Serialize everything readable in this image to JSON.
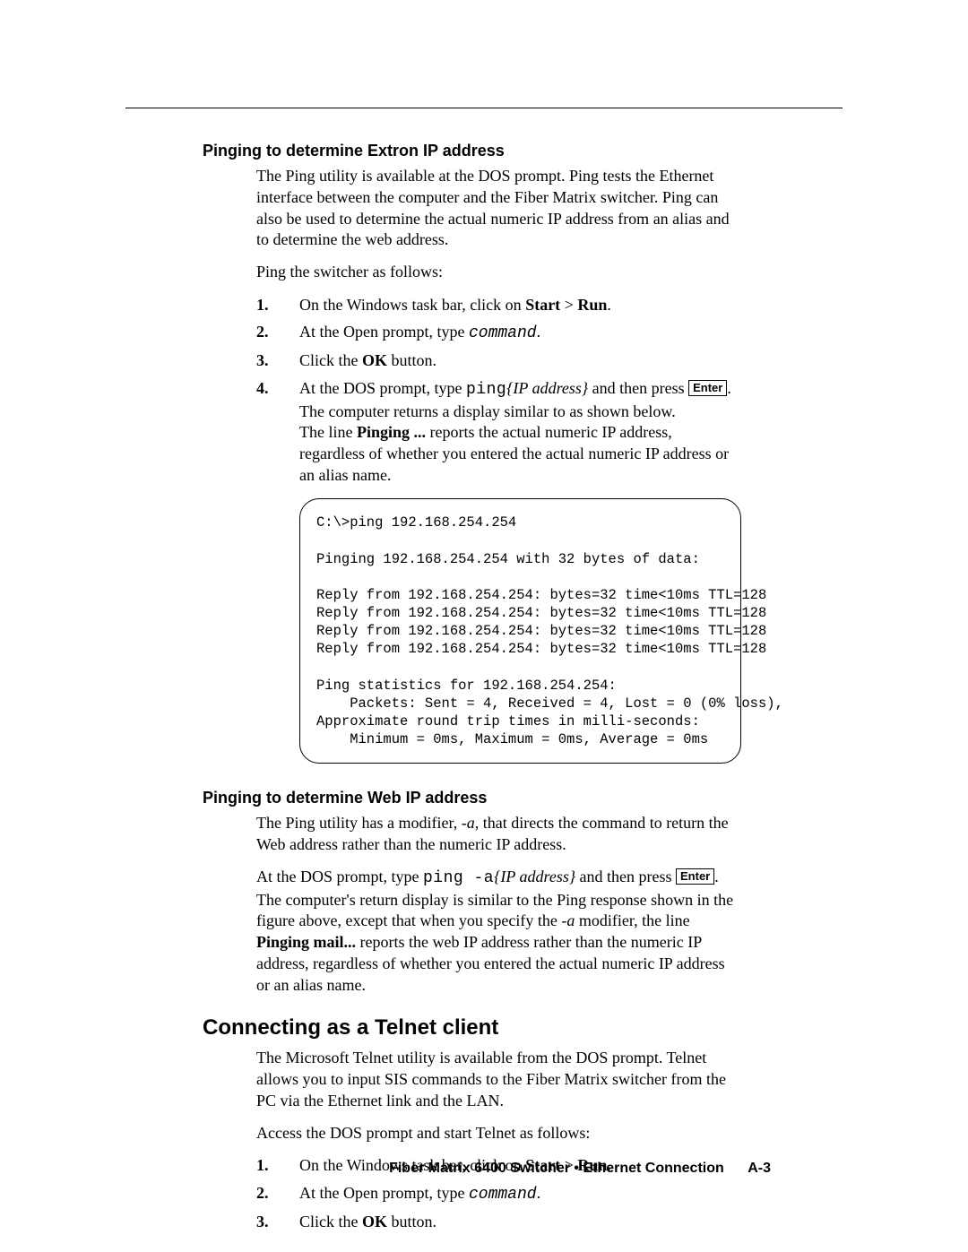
{
  "section1": {
    "heading": "Pinging to determine Extron IP address",
    "p1": "The Ping utility is available at the DOS prompt.  Ping tests the Ethernet interface between the computer and the Fiber Matrix switcher.  Ping can also be used to determine the actual numeric IP address from an alias and to determine the web address.",
    "p2": "Ping the switcher as follows:",
    "steps": {
      "s1": {
        "num": "1",
        "a": "On the Windows task bar, click on ",
        "b": "Start",
        "c": " > ",
        "d": "Run",
        "e": "."
      },
      "s2": {
        "num": "2",
        "a": "At the Open prompt, type ",
        "cmd": "command",
        "b": "."
      },
      "s3": {
        "num": "3",
        "a": "Click the ",
        "ok": "OK",
        "b": " button."
      },
      "s4": {
        "num": "4",
        "a": "At the DOS prompt, type ",
        "cmd": "ping",
        "arg": "{IP address}",
        "b": " and then press ",
        "key": "Enter",
        "c": ".  The computer returns a display similar to as shown below.",
        "sub_a": "The line ",
        "sub_b": "Pinging ...",
        "sub_c": " reports the actual numeric IP address, regardless of whether you entered the actual numeric IP address or an alias name."
      }
    },
    "code": "C:\\>ping 192.168.254.254\n\nPinging 192.168.254.254 with 32 bytes of data:\n\nReply from 192.168.254.254: bytes=32 time<10ms TTL=128\nReply from 192.168.254.254: bytes=32 time<10ms TTL=128\nReply from 192.168.254.254: bytes=32 time<10ms TTL=128\nReply from 192.168.254.254: bytes=32 time<10ms TTL=128\n\nPing statistics for 192.168.254.254:\n    Packets: Sent = 4, Received = 4, Lost = 0 (0% loss),\nApproximate round trip times in milli-seconds:\n    Minimum = 0ms, Maximum = 0ms, Average = 0ms"
  },
  "section2": {
    "heading": "Pinging to determine Web IP address",
    "p1a": "The Ping utility has a modifier, ",
    "p1b": "-a",
    "p1c": ", that directs the command to return the Web address rather than the numeric IP address.",
    "p2": {
      "a": "At the DOS prompt, type ",
      "cmd": "ping -a",
      "arg": "{IP address}",
      "b": " and then press ",
      "key": "Enter",
      "c": ".  The computer's return display is similar to the Ping response shown in the figure above, except that when you specify the ",
      "d": "-a",
      "e": " modifier, the line ",
      "f": "Pinging mail...",
      "g": " reports the web IP address rather than the numeric IP address, regardless of whether you entered the actual numeric IP address or an alias name."
    }
  },
  "section3": {
    "heading": "Connecting as a Telnet client",
    "p1": "The Microsoft Telnet utility is available from the DOS prompt.  Telnet allows you to input SIS commands to the Fiber Matrix switcher from the PC via the Ethernet link and the LAN.",
    "p2": "Access the DOS prompt and start Telnet as follows:",
    "steps": {
      "s1": {
        "num": "1",
        "a": "On the Windows task bar, click on ",
        "b": "Start",
        "c": " > ",
        "d": "Run",
        "e": "."
      },
      "s2": {
        "num": "2",
        "a": "At the Open prompt, type ",
        "cmd": "command",
        "b": "."
      },
      "s3": {
        "num": "3",
        "a": "Click the ",
        "ok": "OK",
        "b": " button."
      }
    }
  },
  "footer": {
    "title": "Fiber Matrix 6400 Switcher • Ethernet Connection",
    "page": "A-3"
  }
}
